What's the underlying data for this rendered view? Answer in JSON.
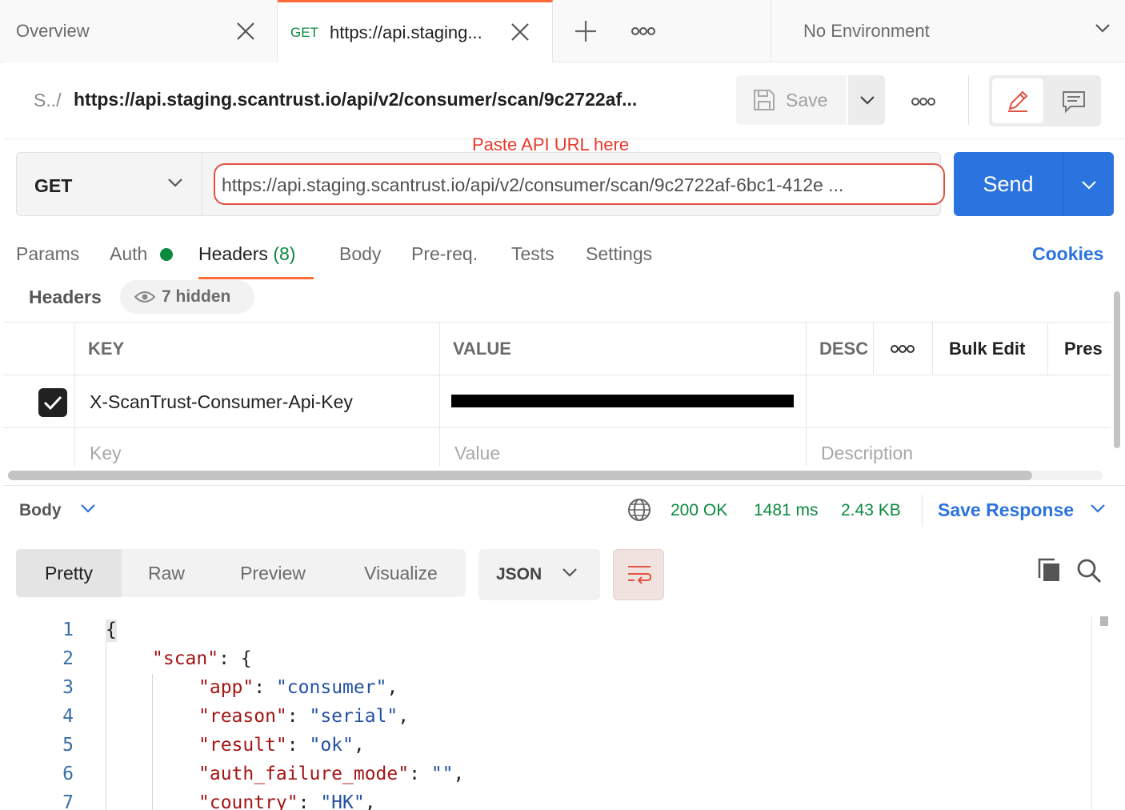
{
  "tabs": [
    {
      "label": "Overview"
    },
    {
      "method": "GET",
      "label": "https://api.staging..."
    }
  ],
  "environment": {
    "label": "No Environment"
  },
  "request": {
    "breadcrumb_prefix": "S../",
    "title": "https://api.staging.scantrust.io/api/v2/consumer/scan/9c2722af...",
    "save_label": "Save",
    "annotation": "Paste API URL here",
    "method": "GET",
    "url": "https://api.staging.scantrust.io/api/v2/consumer/scan/9c2722af-6bc1-412e ...",
    "send_label": "Send"
  },
  "request_tabs": {
    "params": "Params",
    "auth": "Auth",
    "headers": "Headers",
    "headers_count": "(8)",
    "body": "Body",
    "prereq": "Pre-req.",
    "tests": "Tests",
    "settings": "Settings",
    "cookies": "Cookies",
    "auth_status_color": "#0b8a3f"
  },
  "headers_section": {
    "label": "Headers",
    "hidden": "7 hidden",
    "columns": {
      "key": "KEY",
      "value": "VALUE",
      "desc": "DESC",
      "bulk_edit": "Bulk Edit",
      "presets": "Pres"
    },
    "rows": [
      {
        "checked": true,
        "key": "X-ScanTrust-Consumer-Api-Key",
        "value_redacted": true
      }
    ],
    "placeholders": {
      "key": "Key",
      "value": "Value",
      "description": "Description"
    }
  },
  "response": {
    "body_label": "Body",
    "status": "200 OK",
    "time": "1481 ms",
    "size": "2.43 KB",
    "save_label": "Save Response",
    "formats": [
      "Pretty",
      "Raw",
      "Preview",
      "Visualize"
    ],
    "selected_format": "Pretty",
    "language": "JSON"
  },
  "code_lines": {
    "n1": "1",
    "n2": "2",
    "n3": "3",
    "n4": "4",
    "n5": "5",
    "n6": "6",
    "n7": "7",
    "l1": "{",
    "l2_key": "\"scan\"",
    "l2_rest": ": {",
    "l3_key": "\"app\"",
    "l3_sep": ": ",
    "l3_val": "\"consumer\"",
    "l3_end": ",",
    "l4_key": "\"reason\"",
    "l4_sep": ": ",
    "l4_val": "\"serial\"",
    "l4_end": ",",
    "l5_key": "\"result\"",
    "l5_sep": ": ",
    "l5_val": "\"ok\"",
    "l5_end": ",",
    "l6_key": "\"auth_failure_mode\"",
    "l6_sep": ": ",
    "l6_val": "\"\"",
    "l6_end": ",",
    "l7_key": "\"country\"",
    "l7_sep": ": ",
    "l7_val": "\"HK\"",
    "l7_end": ","
  },
  "colors": {
    "accent": "#ff6c37",
    "primary": "#2b73de",
    "success": "#0b8a3f",
    "highlight": "#e25241"
  }
}
